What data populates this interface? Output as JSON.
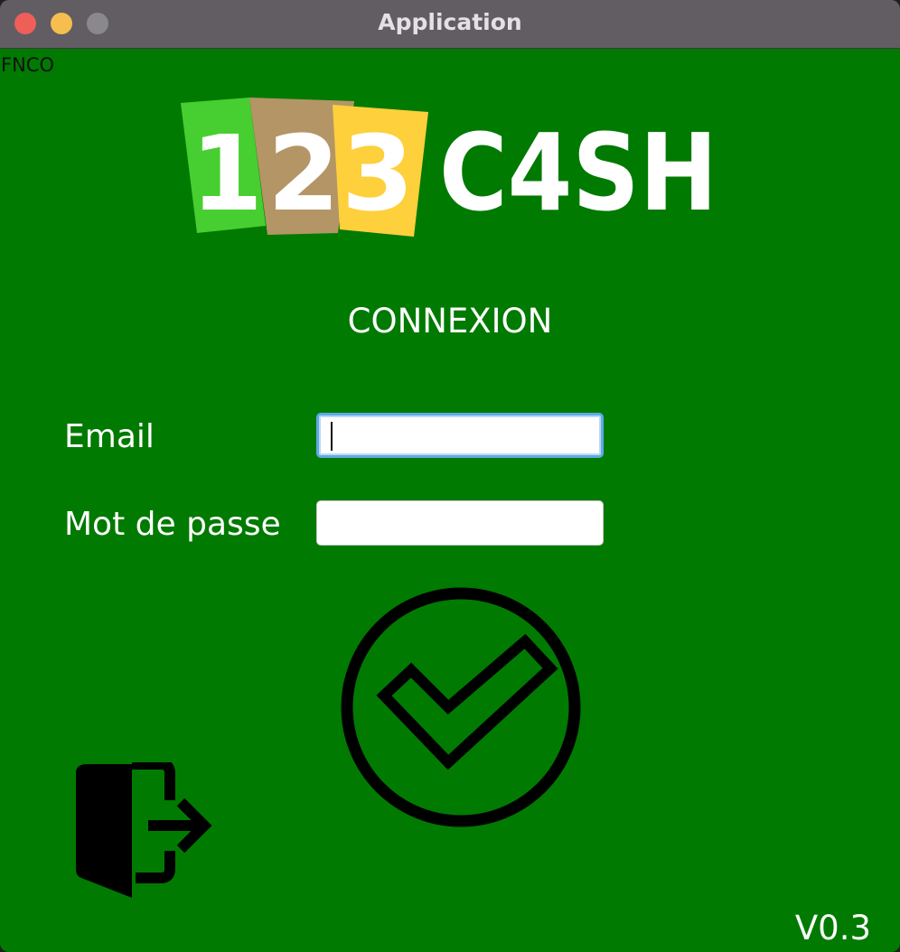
{
  "window": {
    "title": "Application"
  },
  "content": {
    "corner_text": "FNCO",
    "logo": {
      "text": "123C4SH",
      "colors": [
        "#47cf31",
        "#b49565",
        "#fdd03c"
      ]
    },
    "heading": "CONNEXION",
    "form": {
      "email_label": "Email",
      "email_value": "",
      "password_label": "Mot de passe",
      "password_value": ""
    },
    "submit_icon": "check-circle-icon",
    "exit_icon": "exit-door-icon",
    "version": "V0.3"
  },
  "colors": {
    "background": "#017a01",
    "titlebar": "#615d63",
    "focus": "#5fa9e8"
  }
}
